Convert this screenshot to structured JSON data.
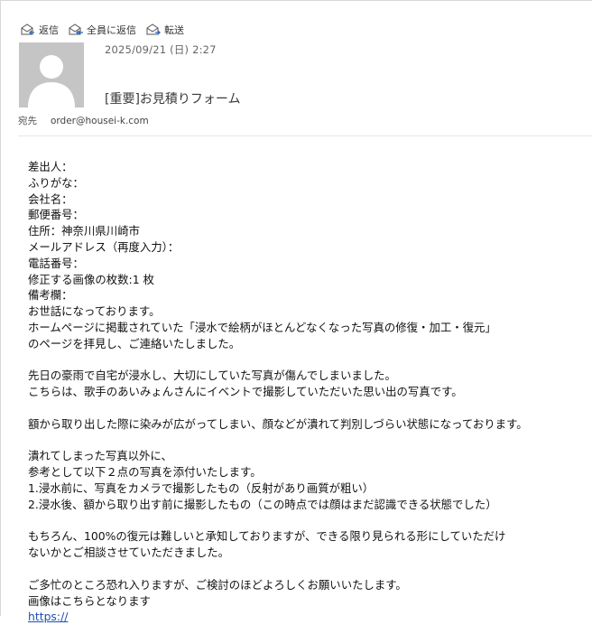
{
  "toolbar": {
    "reply_label": "返信",
    "reply_all_label": "全員に返信",
    "forward_label": "転送"
  },
  "header": {
    "date": "2025/09/21 (日) 2:27",
    "subject": "[重要]お見積りフォーム",
    "to_label": "宛先",
    "to_value": "order@housei-k.com"
  },
  "body": {
    "sender": "差出人：",
    "furigana": "ふりがな：",
    "company": "会社名：",
    "postal": "郵便番号：",
    "address": "住所：神奈川県川崎市",
    "email_confirm": "メールアドレス（再度入力）：",
    "phone": "電話番号：",
    "image_count": "修正する画像の枚数:1 枚",
    "notes": "備考欄：",
    "greeting": "お世話になっております。",
    "intro_1": "ホームページに掲載されていた「浸水で絵柄がほとんどなくなった写真の修復・加工・復元」",
    "intro_2": "のページを拝見し、ご連絡いたしました。",
    "story_1": "先日の豪雨で自宅が浸水し、大切にしていた写真が傷んでしまいました。",
    "story_2": "こちらは、歌手のあいみょんさんにイベントで撮影していただいた思い出の写真です。",
    "damage": "額から取り出した際に染みが広がってしまい、顔などが潰れて判別しづらい状態になっております。",
    "attach_1": "潰れてしまった写真以外に、",
    "attach_2": "参考として以下２点の写真を添付いたします。",
    "attach_3": "1.浸水前に、写真をカメラで撮影したもの（反射があり画質が粗い）",
    "attach_4": "2.浸水後、額から取り出す前に撮影したもの（この時点では顔はまだ認識できる状態でした）",
    "request_1": "もちろん、100%の復元は難しいと承知しておりますが、できる限り見られる形にしていただけ",
    "request_2": "ないかとご相談させていただきました。",
    "closing": "ご多忙のところ恐れ入りますが、ご検討のほどよろしくお願いいたします。",
    "image_here": "画像はこちらとなります",
    "link_text": "https://"
  }
}
